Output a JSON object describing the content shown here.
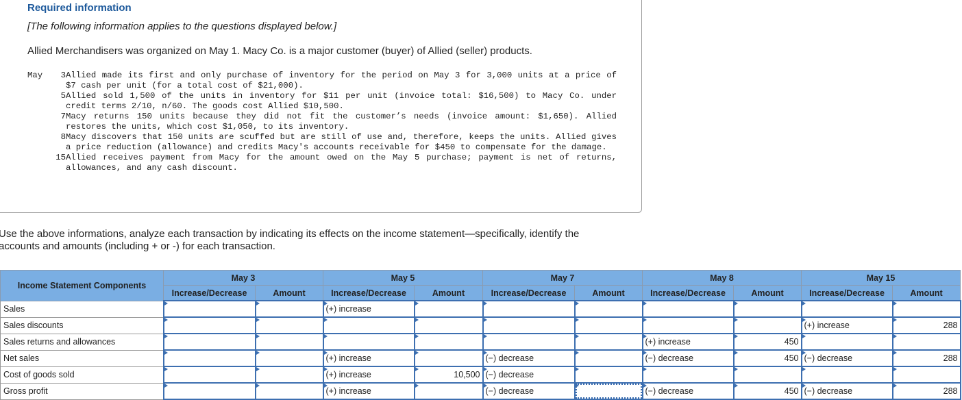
{
  "info": {
    "title": "Required information",
    "note": "[The following information applies to the questions displayed below.]",
    "intro": "Allied Merchandisers was organized on May 1. Macy Co. is a major customer (buyer) of Allied (seller) products.",
    "month": "May",
    "events": [
      {
        "day": "3",
        "text": "Allied made its first and only purchase of inventory for the period on May 3 for 3,000 units at a price of $7 cash per unit (for a total cost of $21,000)."
      },
      {
        "day": "5",
        "text": "Allied sold 1,500 of the units in inventory for $11 per unit (invoice total: $16,500) to Macy Co. under credit terms 2/10, n/60. The goods cost Allied $10,500."
      },
      {
        "day": "7",
        "text": "Macy returns 150 units because they did not fit the customer’s needs (invoice amount: $1,650). Allied restores the units, which cost $1,050, to its inventory."
      },
      {
        "day": "8",
        "text": "Macy discovers that 150 units are scuffed but are still of use and, therefore, keeps the units. Allied gives a price reduction (allowance) and credits Macy's accounts receivable for $450 to compensate for the damage."
      },
      {
        "day": "15",
        "text": "Allied receives payment from Macy for the amount owed on the May 5 purchase; payment is net of returns, allowances, and any cash discount."
      }
    ]
  },
  "instructions": "Use the above informations, analyze each transaction by indicating its effects on the income statement—specifically, identify the accounts and amounts (including + or -) for each transaction.",
  "table": {
    "corner": "Income Statement Components",
    "dates": [
      "May 3",
      "May 5",
      "May 7",
      "May 8",
      "May 15"
    ],
    "sub_inc": "Increase/Decrease",
    "sub_amt": "Amount",
    "rows": [
      {
        "label": "Sales",
        "cells": [
          "",
          "",
          "(+) increase",
          "",
          "",
          "",
          "",
          "",
          "",
          ""
        ]
      },
      {
        "label": "Sales discounts",
        "cells": [
          "",
          "",
          "",
          "",
          "",
          "",
          "",
          "",
          "(+) increase",
          "288"
        ]
      },
      {
        "label": "Sales returns and allowances",
        "cells": [
          "",
          "",
          "",
          "",
          "",
          "",
          "(+) increase",
          "450",
          "",
          ""
        ]
      },
      {
        "label": "Net sales",
        "cells": [
          "",
          "",
          "(+) increase",
          "",
          "(−) decrease",
          "",
          "(−) decrease",
          "450",
          "(−) decrease",
          "288"
        ]
      },
      {
        "label": "Cost of goods sold",
        "cells": [
          "",
          "",
          "(+) increase",
          "10,500",
          "(−) decrease",
          "",
          "",
          "",
          "",
          ""
        ]
      },
      {
        "label": "Gross profit",
        "cells": [
          "",
          "",
          "(+) increase",
          "",
          "(−) decrease",
          "",
          "(−) decrease",
          "450",
          "(−) decrease",
          "288"
        ]
      }
    ]
  }
}
